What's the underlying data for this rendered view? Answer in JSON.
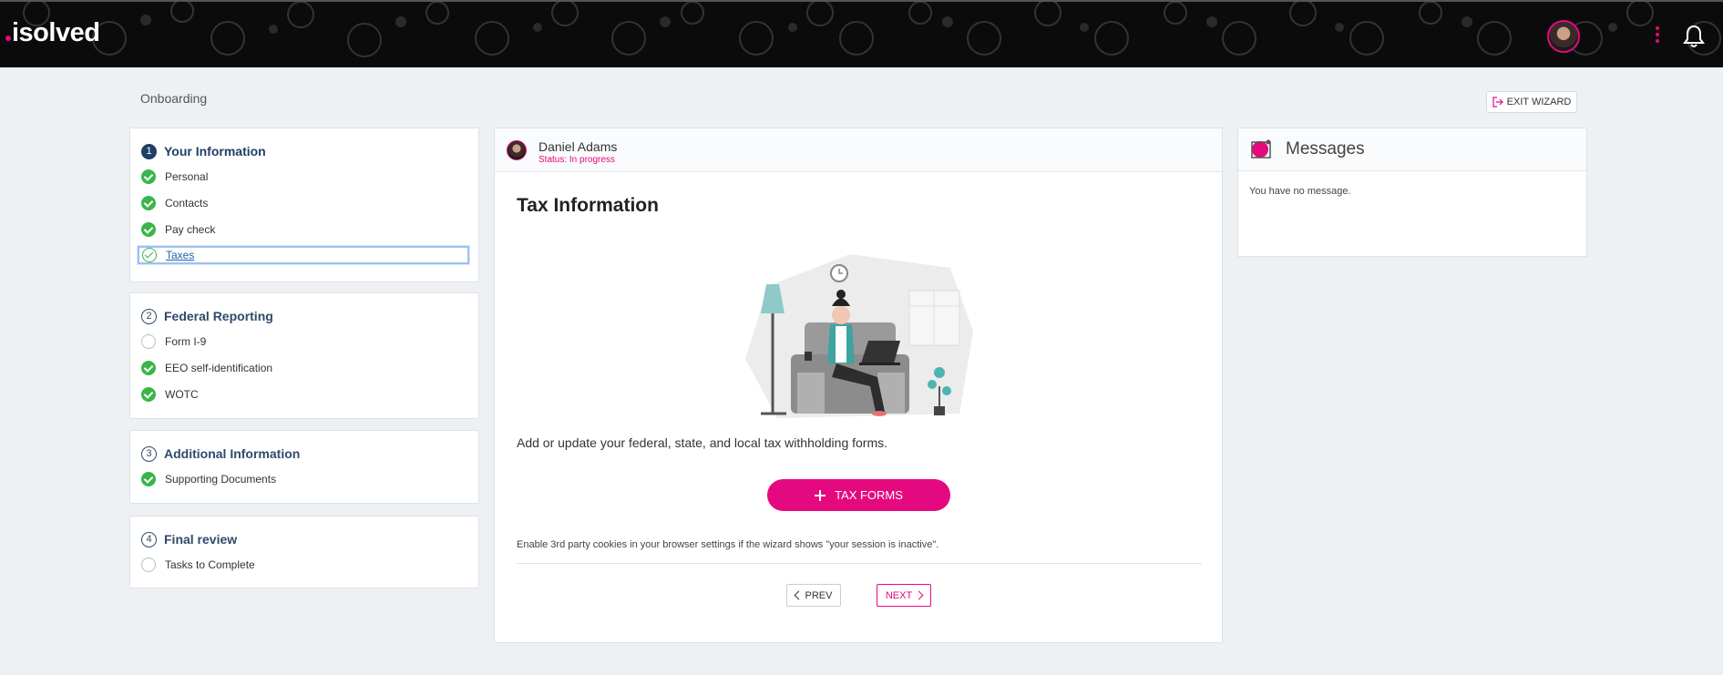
{
  "header": {
    "logo_text": "isolved",
    "brand_color": "#e5097f"
  },
  "page": {
    "title": "Onboarding",
    "exit_label": "EXIT WIZARD"
  },
  "steps": [
    {
      "number": "1",
      "title": "Your Information",
      "items": [
        {
          "label": "Personal",
          "state": "done"
        },
        {
          "label": "Contacts",
          "state": "done"
        },
        {
          "label": "Pay check",
          "state": "done"
        },
        {
          "label": "Taxes",
          "state": "current"
        }
      ]
    },
    {
      "number": "2",
      "title": "Federal Reporting",
      "items": [
        {
          "label": "Form I-9",
          "state": "todo"
        },
        {
          "label": "EEO self-identification",
          "state": "done"
        },
        {
          "label": "WOTC",
          "state": "done"
        }
      ]
    },
    {
      "number": "3",
      "title": "Additional Information",
      "items": [
        {
          "label": "Supporting Documents",
          "state": "done"
        }
      ]
    },
    {
      "number": "4",
      "title": "Final review",
      "items": [
        {
          "label": "Tasks to Complete",
          "state": "todo"
        }
      ]
    }
  ],
  "main": {
    "employee_name": "Daniel Adams",
    "status": "Status: In progress",
    "section_title": "Tax Information",
    "description": "Add or update your federal, state, and local tax withholding forms.",
    "tax_forms_button": "TAX FORMS",
    "cookie_note": "Enable 3rd party cookies in your browser settings if the wizard shows \"your session is inactive\".",
    "prev_label": "PREV",
    "next_label": "NEXT"
  },
  "messages": {
    "title": "Messages",
    "empty_text": "You have no message."
  }
}
